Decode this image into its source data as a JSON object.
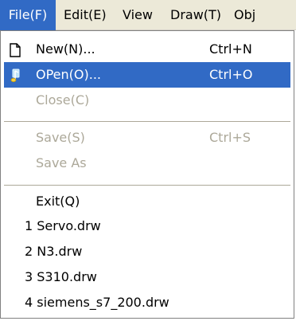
{
  "menubar": {
    "items": [
      {
        "label": "File(F)"
      },
      {
        "label": "Edit(E)"
      },
      {
        "label": "View"
      },
      {
        "label": "Draw(T)"
      },
      {
        "label": "Obj"
      }
    ]
  },
  "file_menu": {
    "new": {
      "label": "New(N)...",
      "shortcut": "Ctrl+N",
      "icon": "new-document-icon"
    },
    "open": {
      "label": "OPen(O)...",
      "shortcut": "Ctrl+O",
      "icon": "open-file-icon"
    },
    "close": {
      "label": "Close(C)"
    },
    "save": {
      "label": "Save(S)",
      "shortcut": "Ctrl+S"
    },
    "save_as": {
      "label": "Save As"
    },
    "exit": {
      "label": "Exit(Q)"
    },
    "recent_files": [
      {
        "label": "1 Servo.drw"
      },
      {
        "label": "2 N3.drw"
      },
      {
        "label": "3 S310.drw"
      },
      {
        "label": "4 siemens_s7_200.drw"
      }
    ]
  },
  "colors": {
    "highlight": "#316ac5",
    "menubar_bg": "#ece9d8",
    "disabled_text": "#aca899"
  }
}
